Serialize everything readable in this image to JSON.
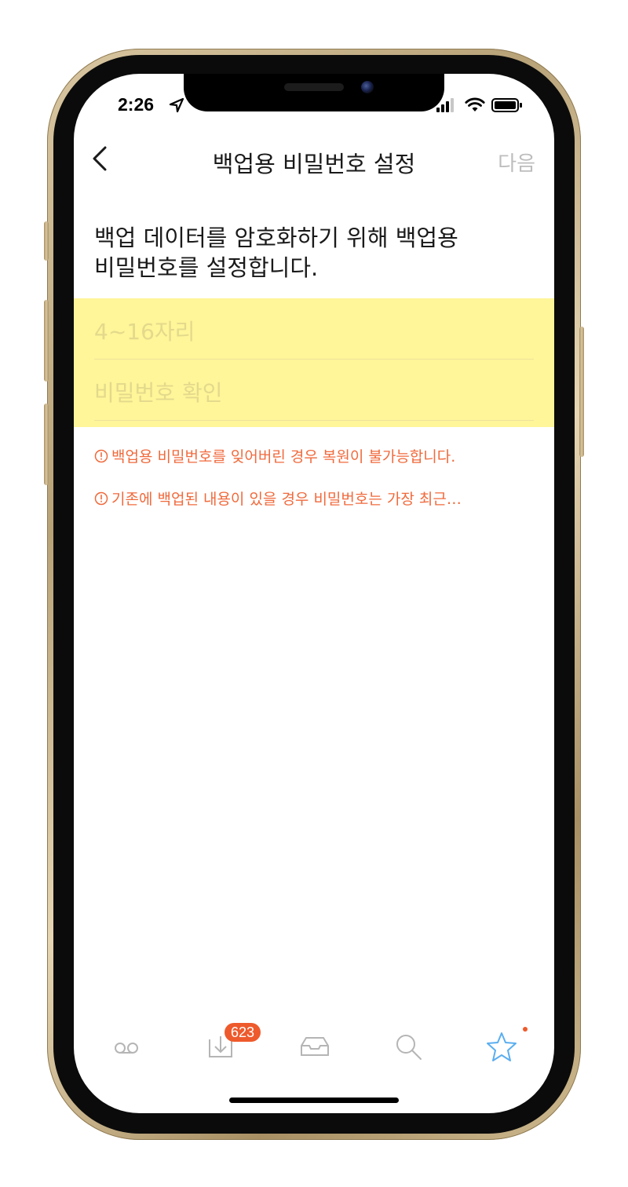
{
  "status_bar": {
    "time": "2:26"
  },
  "nav": {
    "title": "백업용 비밀번호 설정",
    "next_label": "다음"
  },
  "description": {
    "line1": "백업 데이터를 암호화하기 위해 백업용",
    "line2": "비밀번호를 설정합니다."
  },
  "form": {
    "password_placeholder": "4~16자리",
    "confirm_placeholder": "비밀번호 확인"
  },
  "warnings": [
    {
      "text": "백업용 비밀번호를 잊어버린 경우 복원이 불가능합니다."
    },
    {
      "text": "기존에 백업된 내용이 있을 경우 비밀번호는 가장 최근…"
    }
  ],
  "tab_bar": {
    "badge_count": "623",
    "tabs": [
      {
        "icon": "voicemail-icon"
      },
      {
        "icon": "download-tray-icon"
      },
      {
        "icon": "inbox-icon"
      },
      {
        "icon": "search-icon"
      },
      {
        "icon": "star-icon",
        "active": true
      }
    ]
  },
  "colors": {
    "accent": "#ee5a2c",
    "warning_text": "#f06a3c",
    "input_highlight": "#fff599",
    "active_tab": "#5aaef0",
    "inactive_tab": "#b5b5b5"
  }
}
